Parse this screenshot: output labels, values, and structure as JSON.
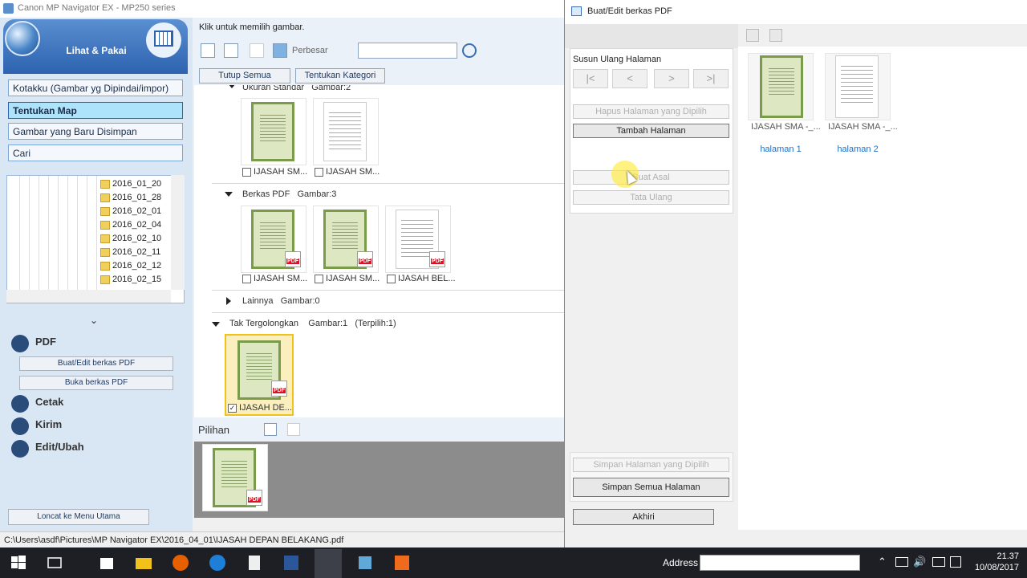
{
  "window": {
    "title": "Canon MP Navigator EX - MP250 series"
  },
  "left": {
    "hero_label": "Lihat & Pakai",
    "nav": [
      "Kotakku (Gambar yg Dipindai/impor)",
      "Tentukan Map",
      "Gambar yang Baru Disimpan",
      "Cari"
    ],
    "tree": [
      "2016_01_20",
      "2016_01_28",
      "2016_02_01",
      "2016_02_04",
      "2016_02_10",
      "2016_02_11",
      "2016_02_12",
      "2016_02_15"
    ],
    "pdf_section": "PDF",
    "pdf_buttons": [
      "Buat/Edit berkas PDF",
      "Buka berkas PDF"
    ],
    "sections": [
      "Cetak",
      "Kirim",
      "Edit/Ubah"
    ],
    "jump_button": "Loncat ke Menu Utama"
  },
  "content": {
    "hint": "Klik untuk memilih gambar.",
    "perbesar": "Perbesar",
    "search_value": "",
    "close_all": "Tutup Semua",
    "category": "Tentukan Kategori",
    "group1": {
      "label": "Ukuran Standar",
      "count": "Gambar:2",
      "items": [
        "IJASAH SM...",
        "IJASAH SM..."
      ]
    },
    "group2": {
      "label": "Berkas PDF",
      "count": "Gambar:3",
      "items": [
        "IJASAH SM...",
        "IJASAH SM...",
        "IJASAH BEL..."
      ]
    },
    "group3": {
      "label": "Lainnya",
      "count": "Gambar:0"
    },
    "group4": {
      "label": "Tak Tergolongkan",
      "count": "Gambar:1",
      "selected": "(Terpilih:1)",
      "items": [
        "IJASAH DE..."
      ]
    },
    "pilihan": "Pilihan"
  },
  "status": {
    "path": "C:\\Users\\asdf\\Pictures\\MP Navigator EX\\2016_04_01\\IJASAH DEPAN BELAKANG.pdf"
  },
  "dialog": {
    "title": "Buat/Edit berkas PDF",
    "reorder_label": "Susun Ulang Halaman",
    "nav_glyphs": [
      "|<",
      "<",
      ">",
      ">|"
    ],
    "delete_selected": "Hapus Halaman yang Dipilih",
    "add_page": "Tambah Halaman",
    "original": "Buat Asal",
    "reset": "Tata Ulang",
    "save_selected": "Simpan Halaman yang Dipilih",
    "save_all": "Simpan Semua Halaman",
    "finish": "Akhiri",
    "pages": [
      {
        "file": "IJASAH SMA -_...",
        "label": "halaman 1"
      },
      {
        "file": "IJASAH SMA -_...",
        "label": "halaman 2"
      }
    ]
  },
  "taskbar": {
    "address_label": "Address",
    "time": "21.37",
    "date": "10/08/2017"
  }
}
